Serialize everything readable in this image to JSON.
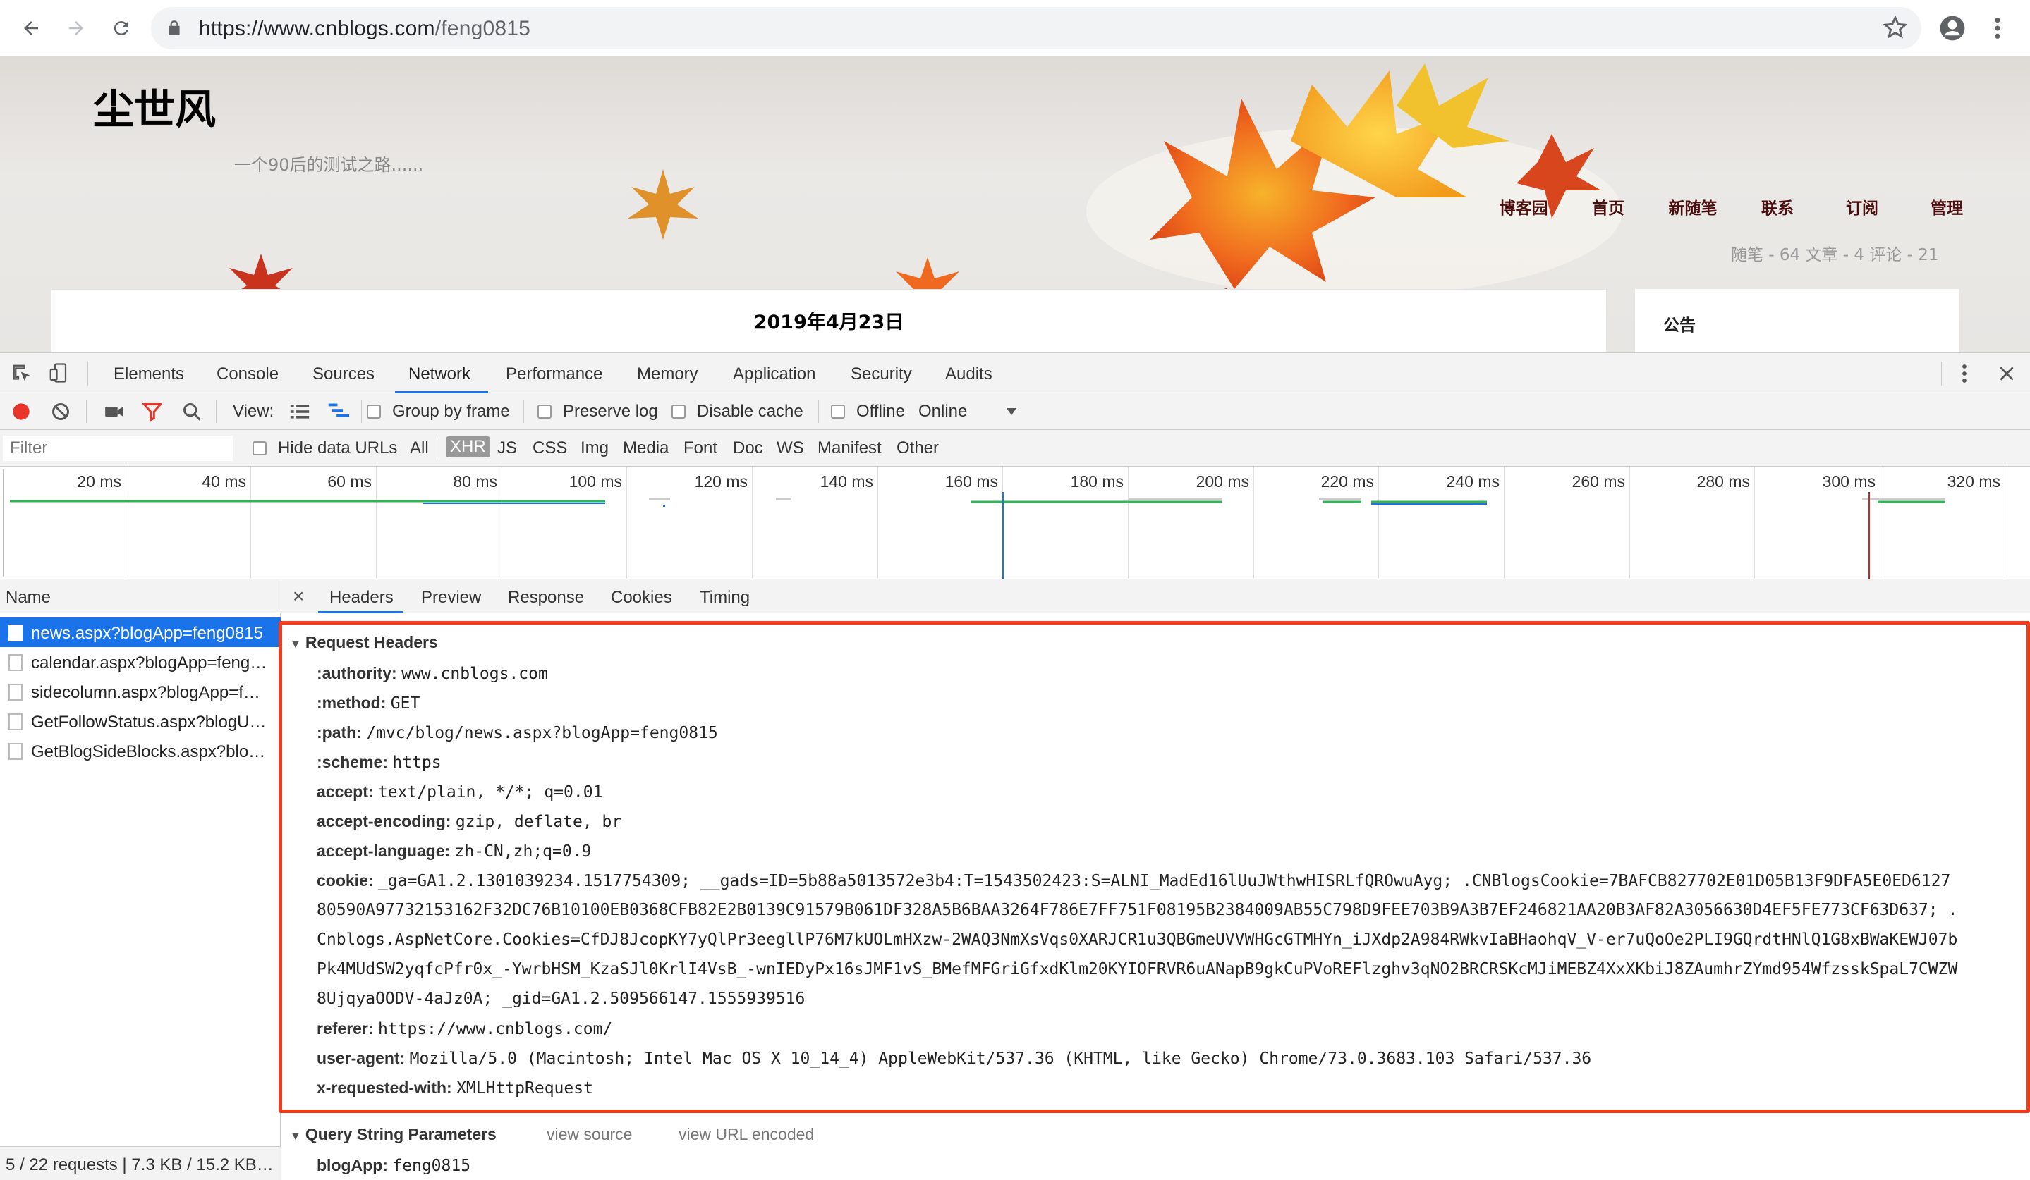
{
  "browser": {
    "url_host": "https://www.cnblogs.com",
    "url_path": "/feng0815"
  },
  "blog": {
    "title": "尘世风",
    "subtitle": "一个90后的测试之路......",
    "nav": [
      "博客园",
      "首页",
      "新随笔",
      "联系",
      "订阅",
      "管理"
    ],
    "stats": "随笔 - 64  文章 - 4  评论 - 21",
    "post_date": "2019年4月23日",
    "notice_title": "公告"
  },
  "devtools": {
    "tabs": [
      "Elements",
      "Console",
      "Sources",
      "Network",
      "Performance",
      "Memory",
      "Application",
      "Security",
      "Audits"
    ],
    "active_tab": "Network",
    "toolbar": {
      "view_label": "View:",
      "group_by_frame": "Group by frame",
      "preserve_log": "Preserve log",
      "disable_cache": "Disable cache",
      "offline": "Offline",
      "throttle": "Online"
    },
    "filter": {
      "placeholder": "Filter",
      "hide_data_urls": "Hide data URLs",
      "types": [
        "All",
        "XHR",
        "JS",
        "CSS",
        "Img",
        "Media",
        "Font",
        "Doc",
        "WS",
        "Manifest",
        "Other"
      ],
      "selected_type": "XHR"
    },
    "timeline_ticks": [
      "20 ms",
      "40 ms",
      "60 ms",
      "80 ms",
      "100 ms",
      "120 ms",
      "140 ms",
      "160 ms",
      "180 ms",
      "200 ms",
      "220 ms",
      "240 ms",
      "260 ms",
      "280 ms",
      "300 ms",
      "320 ms"
    ],
    "name_header": "Name",
    "requests": [
      "news.aspx?blogApp=feng0815",
      "calendar.aspx?blogApp=feng…",
      "sidecolumn.aspx?blogApp=f…",
      "GetFollowStatus.aspx?blogU…",
      "GetBlogSideBlocks.aspx?blo…"
    ],
    "status_bar": "5 / 22 requests | 7.3 KB / 15.2 KB…",
    "detail_tabs": [
      "Headers",
      "Preview",
      "Response",
      "Cookies",
      "Timing"
    ],
    "active_detail_tab": "Headers",
    "request_headers_title": "Request Headers",
    "headers": [
      {
        "k": ":authority:",
        "v": "www.cnblogs.com"
      },
      {
        "k": ":method:",
        "v": "GET"
      },
      {
        "k": ":path:",
        "v": "/mvc/blog/news.aspx?blogApp=feng0815"
      },
      {
        "k": ":scheme:",
        "v": "https"
      },
      {
        "k": "accept:",
        "v": "text/plain, */*; q=0.01"
      },
      {
        "k": "accept-encoding:",
        "v": "gzip, deflate, br"
      },
      {
        "k": "accept-language:",
        "v": "zh-CN,zh;q=0.9"
      }
    ],
    "cookie_key": "cookie:",
    "cookie_lines": [
      "_ga=GA1.2.1301039234.1517754309; __gads=ID=5b88a5013572e3b4:T=1543502423:S=ALNI_MadEd16lUuJWthwHISRLfQROwuAyg; .CNBlogsCookie=7BAFCB827702E01D05B13F9DFA5E0ED6127",
      "80590A97732153162F32DC76B10100EB0368CFB82E2B0139C91579B061DF328A5B6BAA3264F786E7FF751F08195B2384009AB55C798D9FEE703B9A3B7EF246821AA20B3AF82A3056630D4EF5FE773CF63D637; .",
      "Cnblogs.AspNetCore.Cookies=CfDJ8JcopKY7yQlPr3eegllP76M7kUOLmHXzw-2WAQ3NmXsVqs0XARJCR1u3QBGmeUVVWHGcGTMHYn_iJXdp2A984RWkvIaBHaohqV_V-er7uQoOe2PLI9GQrdtHNlQ1G8xBWaKEWJ07b",
      "Pk4MUdSW2yqfcPfr0x_-YwrbHSM_KzaSJl0KrlI4VsB_-wnIEDyPx16sJMF1vS_BMefMFGriGfxdKlm20KYIOFRVR6uANapB9gkCuPVoREFlzghv3qNO2BRCRSKcMJiMEBZ4XxXKbiJ8ZAumhrZYmd954WfzsskSpaL7CWZW",
      "8UjqyaOODV-4aJz0A; _gid=GA1.2.509566147.1555939516"
    ],
    "headers_after": [
      {
        "k": "referer:",
        "v": "https://www.cnblogs.com/"
      },
      {
        "k": "user-agent:",
        "v": "Mozilla/5.0 (Macintosh; Intel Mac OS X 10_14_4) AppleWebKit/537.36 (KHTML, like Gecko) Chrome/73.0.3683.103 Safari/537.36"
      },
      {
        "k": "x-requested-with:",
        "v": "XMLHttpRequest"
      }
    ],
    "query_title": "Query String Parameters",
    "view_source": "view source",
    "view_url_encoded": "view URL encoded",
    "query_params": [
      {
        "k": "blogApp:",
        "v": "feng0815"
      }
    ]
  },
  "colors": {
    "accent": "#1a73e8",
    "highlight_box": "#f23a1d",
    "record": "#e8342a"
  }
}
